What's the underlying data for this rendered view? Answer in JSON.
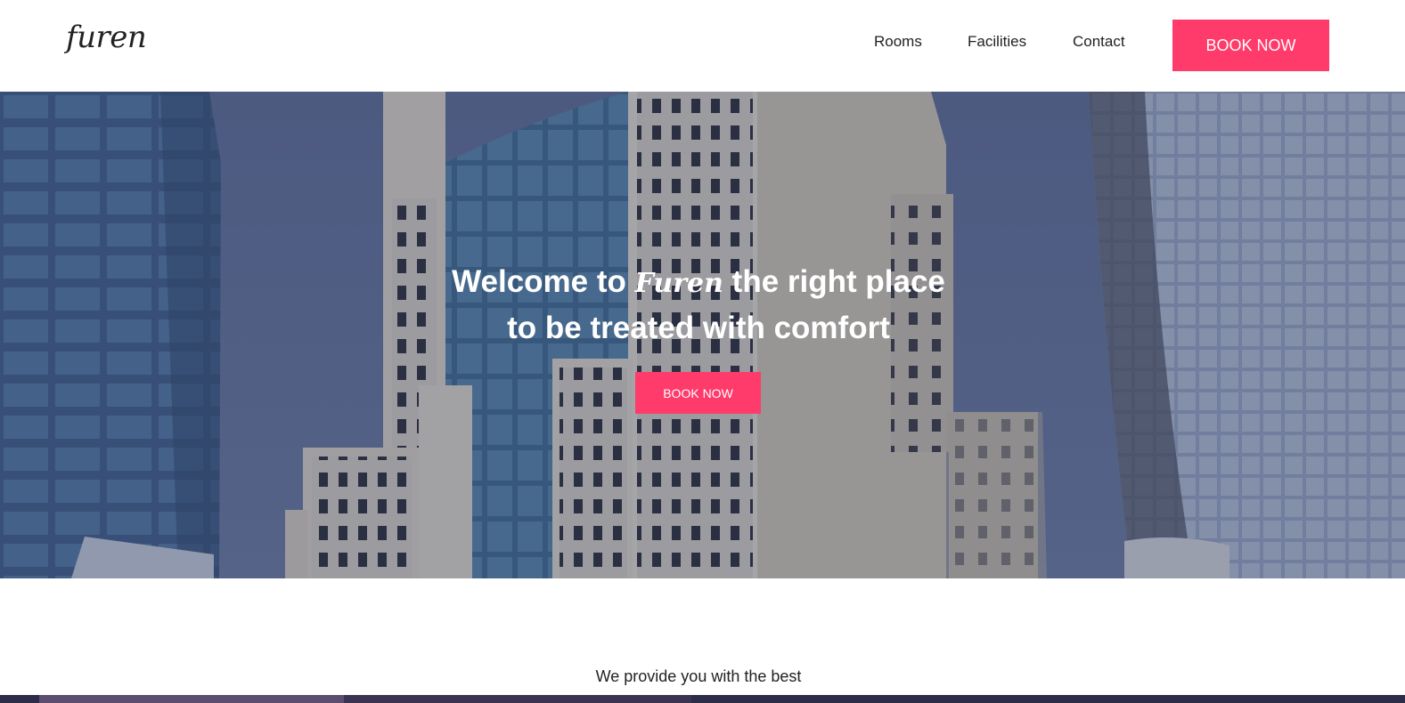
{
  "navbar": {
    "logo": "furen",
    "links": [
      {
        "label": "Rooms"
      },
      {
        "label": "Facilities"
      },
      {
        "label": "Contact"
      }
    ],
    "book_label": "BOOK NOW"
  },
  "hero": {
    "title_before": "Welcome to ",
    "title_brand": "Furen",
    "title_after": " the right place",
    "title_line2": "to be treated with comfort",
    "book_label": "BOOK NOW"
  },
  "section": {
    "subtitle": "We provide you with the best"
  },
  "colors": {
    "accent": "#ff3b6b",
    "sky": "#5a6c95",
    "text": "#222222"
  }
}
